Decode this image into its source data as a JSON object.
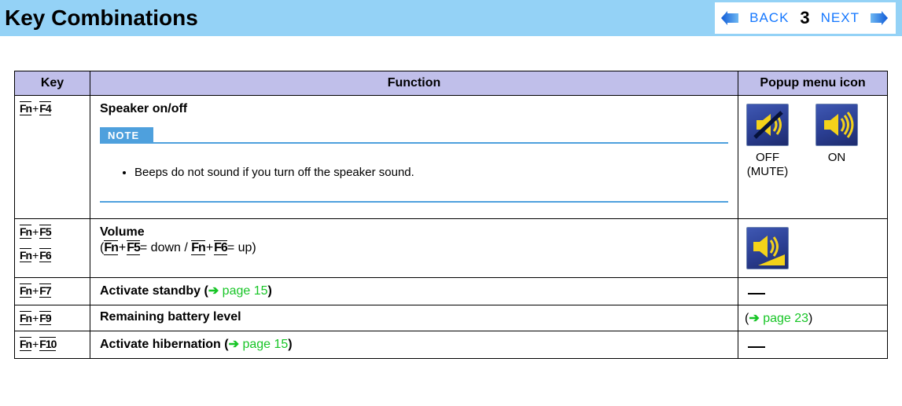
{
  "header": {
    "title": "Key Combinations",
    "back": "BACK",
    "next": "NEXT",
    "page": "3"
  },
  "thead": {
    "key": "Key",
    "function": "Function",
    "icon": "Popup menu icon"
  },
  "rows": {
    "r1": {
      "k_fn": "Fn",
      "k_plus": "+",
      "k_f": "F4",
      "title": "Speaker on/off",
      "note_label": "NOTE",
      "note_item": "Beeps do not sound if you turn off the speaker sound.",
      "off_label_1": "OFF",
      "off_label_2": "(MUTE)",
      "on_label": "ON"
    },
    "r2": {
      "k_fn": "Fn",
      "k_plus": "+",
      "k_f_a": "F5",
      "k_f_b": "F6",
      "title": "Volume",
      "line_open": "(",
      "line_a_fn": "Fn",
      "line_a_plus": "+",
      "line_a_f": "F5",
      "line_a_txt": "= down / ",
      "line_b_fn": "Fn",
      "line_b_plus": "+",
      "line_b_f": "F6",
      "line_b_txt": "= up",
      "line_close": ")"
    },
    "r3": {
      "k_fn": "Fn",
      "k_plus": "+",
      "k_f": "F7",
      "title_a": "Activate standby (",
      "arrow": "➔ ",
      "link": "page 15",
      "title_b": ")"
    },
    "r4": {
      "k_fn": "Fn",
      "k_plus": "+",
      "k_f": "F9",
      "title": "Remaining battery level",
      "icon_open": "(",
      "arrow": "➔ ",
      "link": "page 23",
      "icon_close": ")"
    },
    "r5": {
      "k_fn": "Fn",
      "k_plus": "+",
      "k_f": "F10",
      "title_a": "Activate hibernation (",
      "arrow": "➔ ",
      "link": "page 15",
      "title_b": ")"
    }
  }
}
